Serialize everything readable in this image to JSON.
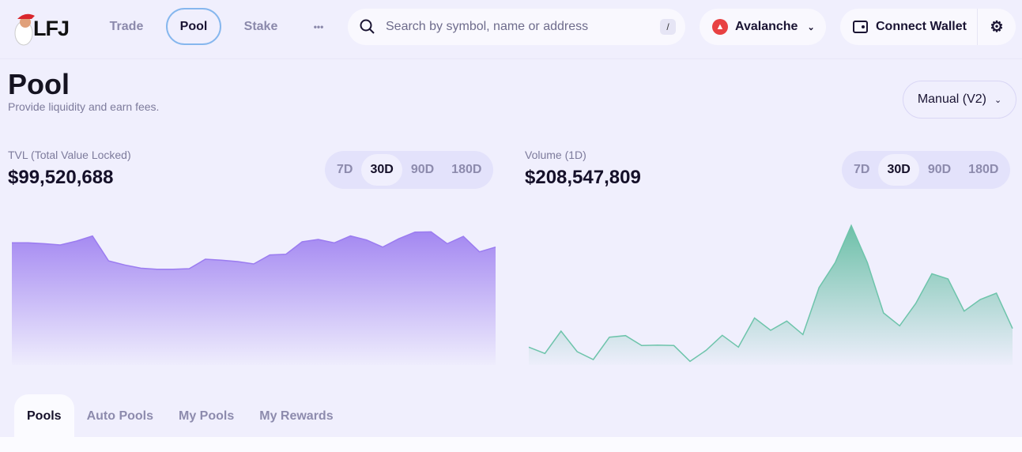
{
  "nav": {
    "logo": "LFJ",
    "trade": "Trade",
    "pool": "Pool",
    "stake": "Stake",
    "more": "•••"
  },
  "search": {
    "placeholder": "Search by symbol, name or address",
    "shortcut": "/"
  },
  "chain": {
    "label": "Avalanche",
    "color": "#e84142"
  },
  "wallet": {
    "label": "Connect Wallet"
  },
  "page": {
    "title": "Pool",
    "subtitle": "Provide liquidity and earn fees.",
    "mode": "Manual (V2)"
  },
  "tvl": {
    "label": "TVL (Total Value Locked)",
    "value": "$99,520,688",
    "ranges": [
      "7D",
      "30D",
      "90D",
      "180D"
    ],
    "selected": "30D"
  },
  "volume": {
    "label": "Volume (1D)",
    "value": "$208,547,809",
    "ranges": [
      "7D",
      "30D",
      "90D",
      "180D"
    ],
    "selected": "30D"
  },
  "tabs": [
    "Pools",
    "Auto Pools",
    "My Pools",
    "My Rewards"
  ],
  "chart_data": [
    {
      "type": "area",
      "title": "TVL (Total Value Locked)",
      "unit": "$M",
      "color": "#9b7cf0",
      "ylim": [
        0,
        117
      ],
      "values": [
        102.9,
        102.9,
        102.2,
        101.2,
        104.3,
        108.4,
        88.5,
        85.2,
        82.6,
        81.8,
        81.8,
        82.2,
        89.8,
        89.0,
        87.9,
        86.0,
        93.2,
        93.8,
        103.7,
        105.6,
        102.9,
        108.4,
        105.2,
        99.5,
        106.2,
        111.5,
        111.7,
        102.2,
        108.1,
        95.7,
        99.5
      ]
    },
    {
      "type": "area",
      "title": "Volume (1D)",
      "unit": "$M",
      "color": "#6ec4ab",
      "ylim": [
        0,
        710
      ],
      "values": [
        117.7,
        87,
        195.7,
        95.9,
        57.6,
        166.3,
        174,
        125.4,
        127.9,
        125.4,
        48.6,
        102.3,
        175.2,
        117.7,
        259.6,
        199.5,
        244.3,
        179,
        406.7,
        528.2,
        708.5,
        528.2,
        283.9,
        221.3,
        330,
        474.5,
        448.9,
        292.9,
        349.2,
        379.9,
        208.5
      ]
    }
  ]
}
